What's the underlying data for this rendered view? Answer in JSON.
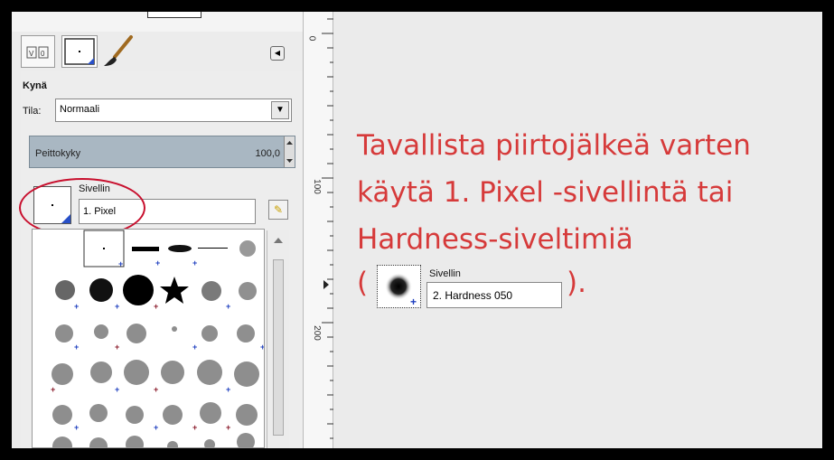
{
  "panel": {
    "tool_title": "Kynä",
    "mode_label": "Tila:",
    "mode_value": "Normaali",
    "opacity_label": "Peittokyky",
    "opacity_value": "100,0",
    "brush_label": "Sivellin",
    "brush_name": "1. Pixel"
  },
  "ruler": {
    "ticks": [
      "0",
      "100",
      "200"
    ]
  },
  "caption": {
    "line1": "Tavallista piirtojälkeä varten",
    "line2": "käytä 1. Pixel -sivellintä tai",
    "line3": "Hardness-siveltimiä",
    "paren_open": "(",
    "paren_close": ")."
  },
  "example": {
    "label": "Sivellin",
    "name": "2. Hardness 050"
  },
  "colors": {
    "annotation_red": "#d63a3a",
    "circle_red": "#c8102e",
    "plus_blue": "#1f3fbf",
    "plus_red": "#8a1a2a"
  }
}
